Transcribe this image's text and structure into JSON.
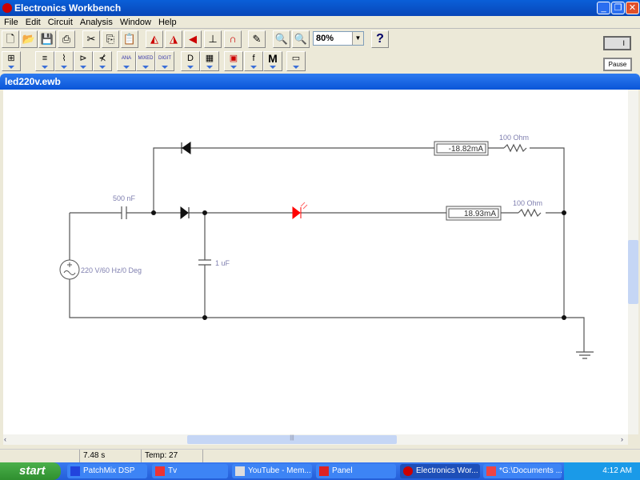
{
  "window": {
    "title": "Electronics Workbench",
    "buttons": [
      "minimize",
      "restore",
      "close"
    ]
  },
  "menu": [
    "File",
    "Edit",
    "Circuit",
    "Analysis",
    "Window",
    "Help"
  ],
  "toolbar": {
    "zoom_value": "80%",
    "help_label": "?",
    "power_label": "I",
    "pause_label": "Pause"
  },
  "toolbar2": {
    "ana": "ANA",
    "mixed": "MIXED",
    "digit": "DIGIT",
    "m": "M",
    "f": "f"
  },
  "document": {
    "title": "led220v.ewb"
  },
  "circuit": {
    "cap1": "500 nF",
    "cap2": "1 uF",
    "source": "220 V/60 Hz/0 Deg",
    "r1": "100  Ohm",
    "r2": "100  Ohm",
    "ammeter1": "-18.82mA",
    "ammeter2": "18.93mA",
    "led_color": "#ff0000"
  },
  "status": {
    "time": "7.48 s",
    "temp": "Temp: 27"
  },
  "taskbar": {
    "start": "start",
    "tasks": [
      "PatchMix DSP",
      "Tv",
      "YouTube - Mem...",
      "Panel",
      "Electronics Wor...",
      "*G:\\Documents ..."
    ],
    "clock": "4:12 AM"
  }
}
